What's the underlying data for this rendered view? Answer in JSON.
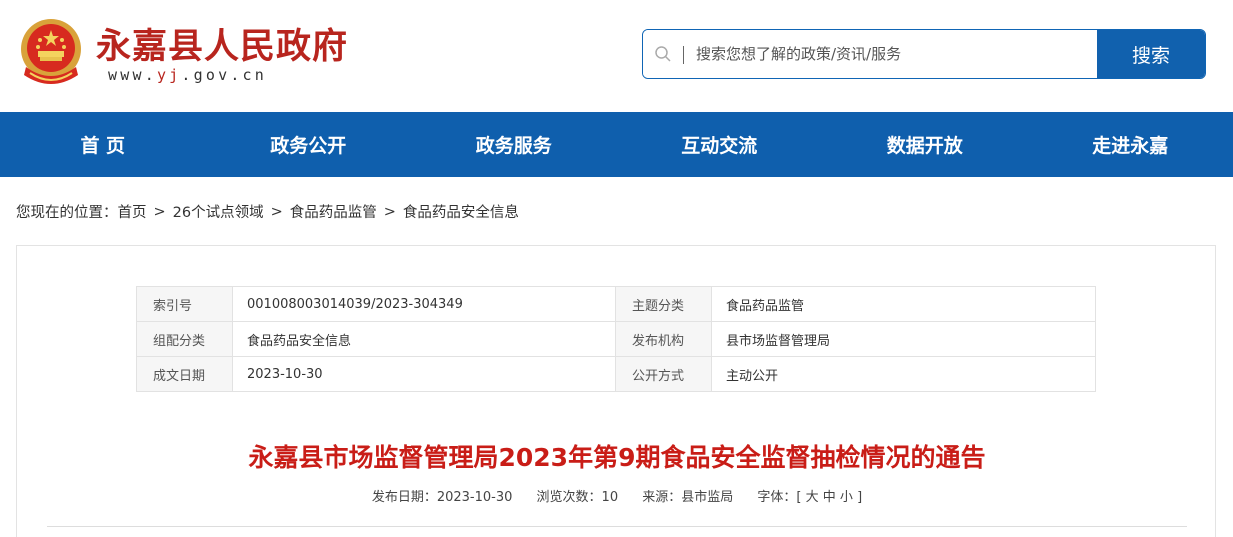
{
  "header": {
    "site_title": "永嘉县人民政府",
    "url_prefix": "www.",
    "url_highlight": "yj",
    "url_suffix": ".gov.cn",
    "emblem_icon": "national-emblem-icon",
    "brand_color": "#b8251e"
  },
  "search": {
    "placeholder": "搜索您想了解的政策/资讯/服务",
    "button_label": "搜索",
    "icon": "search-icon",
    "accent_color": "#1161ae"
  },
  "nav": {
    "items": [
      {
        "label": "首 页"
      },
      {
        "label": "政务公开"
      },
      {
        "label": "政务服务"
      },
      {
        "label": "互动交流"
      },
      {
        "label": "数据开放"
      },
      {
        "label": "走进永嘉"
      }
    ],
    "background": "#0f5fad"
  },
  "breadcrumb": {
    "prefix": "您现在的位置：",
    "items": [
      "首页",
      "26个试点领域",
      "食品药品监管",
      "食品药品安全信息"
    ],
    "separator": ">"
  },
  "metadata": {
    "rows": [
      {
        "k1": "索引号",
        "v1": "001008003014039/2023-304349",
        "k2": "主题分类",
        "v2": "食品药品监管"
      },
      {
        "k1": "组配分类",
        "v1": "食品药品安全信息",
        "k2": "发布机构",
        "v2": "县市场监督管理局"
      },
      {
        "k1": "成文日期",
        "v1": "2023-10-30",
        "k2": "公开方式",
        "v2": "主动公开"
      }
    ]
  },
  "article": {
    "title": "永嘉县市场监督管理局2023年第9期食品安全监督抽检情况的通告",
    "title_color": "#c91d17",
    "publish_date": "发布日期：2023-10-30",
    "views": "浏览次数：10",
    "source": "来源：县市监局",
    "font_size_label": "字体：[",
    "font_large": "大",
    "font_medium": "中",
    "font_small": "小",
    "font_size_close": "]"
  }
}
